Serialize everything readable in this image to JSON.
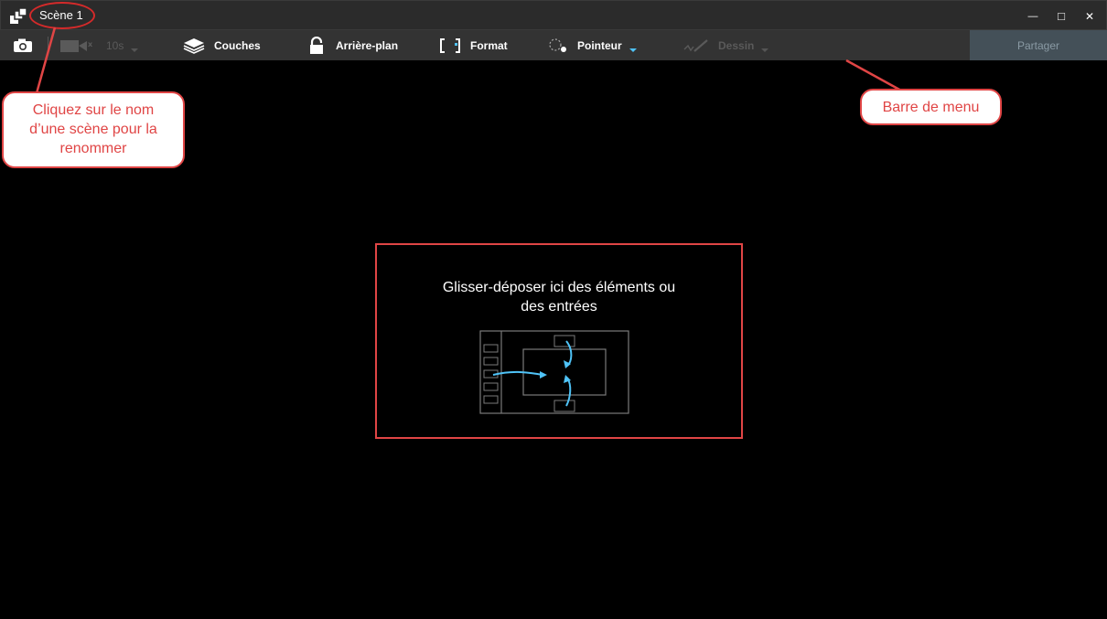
{
  "title_bar": {
    "scene_name": "Scène 1",
    "icons": [
      "app-logo-icon",
      "minimize-icon",
      "maximize-icon",
      "close-icon"
    ],
    "buttons": {
      "minimize": "—",
      "maximize": "□",
      "close": "✕"
    }
  },
  "menu_bar": {
    "snapshot_icon": "camera-icon",
    "record_icon": "video-camera-icon",
    "timer_label": "10s",
    "layers_label": "Couches",
    "background_label": "Arrière-plan",
    "format_label": "Format",
    "pointer_label": "Pointeur",
    "draw_label": "Dessin",
    "share_label": "Partager"
  },
  "annotations": {
    "rename_hint_line1": "Cliquez sur le nom",
    "rename_hint_line2": "d’une scène pour la",
    "rename_hint_line3": "renommer",
    "menu_bar_hint": "Barre de menu"
  },
  "canvas": {
    "drop_hint_line1": "Glisser-déposer ici des éléments ou",
    "drop_hint_line2": "des entrées"
  },
  "colors": {
    "title_bar_bg": "#2b2b2b",
    "menu_bar_bg": "#333333",
    "accent": "#4fc3f7",
    "annotation_red": "#e04545",
    "share_bg": "#445058"
  }
}
